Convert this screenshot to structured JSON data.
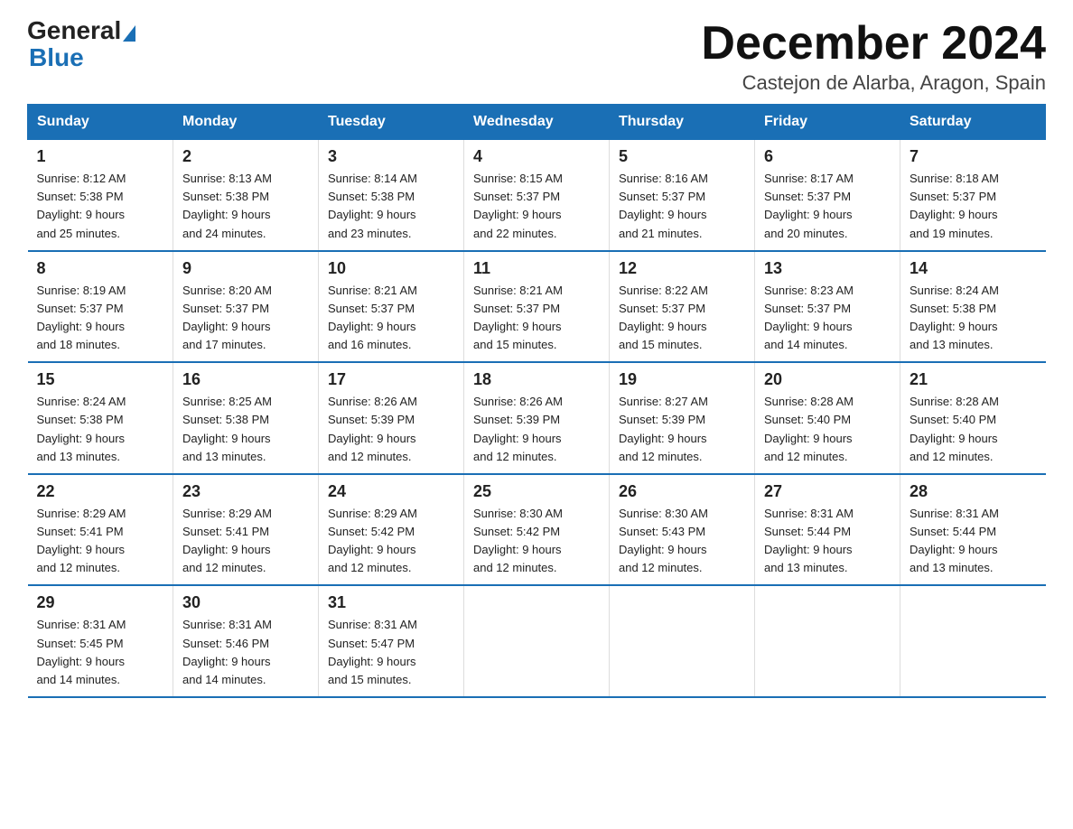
{
  "header": {
    "logo_general": "General",
    "logo_blue": "Blue",
    "month_title": "December 2024",
    "location": "Castejon de Alarba, Aragon, Spain"
  },
  "weekdays": [
    "Sunday",
    "Monday",
    "Tuesday",
    "Wednesday",
    "Thursday",
    "Friday",
    "Saturday"
  ],
  "weeks": [
    [
      {
        "day": "1",
        "sunrise": "8:12 AM",
        "sunset": "5:38 PM",
        "daylight": "9 hours and 25 minutes."
      },
      {
        "day": "2",
        "sunrise": "8:13 AM",
        "sunset": "5:38 PM",
        "daylight": "9 hours and 24 minutes."
      },
      {
        "day": "3",
        "sunrise": "8:14 AM",
        "sunset": "5:38 PM",
        "daylight": "9 hours and 23 minutes."
      },
      {
        "day": "4",
        "sunrise": "8:15 AM",
        "sunset": "5:37 PM",
        "daylight": "9 hours and 22 minutes."
      },
      {
        "day": "5",
        "sunrise": "8:16 AM",
        "sunset": "5:37 PM",
        "daylight": "9 hours and 21 minutes."
      },
      {
        "day": "6",
        "sunrise": "8:17 AM",
        "sunset": "5:37 PM",
        "daylight": "9 hours and 20 minutes."
      },
      {
        "day": "7",
        "sunrise": "8:18 AM",
        "sunset": "5:37 PM",
        "daylight": "9 hours and 19 minutes."
      }
    ],
    [
      {
        "day": "8",
        "sunrise": "8:19 AM",
        "sunset": "5:37 PM",
        "daylight": "9 hours and 18 minutes."
      },
      {
        "day": "9",
        "sunrise": "8:20 AM",
        "sunset": "5:37 PM",
        "daylight": "9 hours and 17 minutes."
      },
      {
        "day": "10",
        "sunrise": "8:21 AM",
        "sunset": "5:37 PM",
        "daylight": "9 hours and 16 minutes."
      },
      {
        "day": "11",
        "sunrise": "8:21 AM",
        "sunset": "5:37 PM",
        "daylight": "9 hours and 15 minutes."
      },
      {
        "day": "12",
        "sunrise": "8:22 AM",
        "sunset": "5:37 PM",
        "daylight": "9 hours and 15 minutes."
      },
      {
        "day": "13",
        "sunrise": "8:23 AM",
        "sunset": "5:37 PM",
        "daylight": "9 hours and 14 minutes."
      },
      {
        "day": "14",
        "sunrise": "8:24 AM",
        "sunset": "5:38 PM",
        "daylight": "9 hours and 13 minutes."
      }
    ],
    [
      {
        "day": "15",
        "sunrise": "8:24 AM",
        "sunset": "5:38 PM",
        "daylight": "9 hours and 13 minutes."
      },
      {
        "day": "16",
        "sunrise": "8:25 AM",
        "sunset": "5:38 PM",
        "daylight": "9 hours and 13 minutes."
      },
      {
        "day": "17",
        "sunrise": "8:26 AM",
        "sunset": "5:39 PM",
        "daylight": "9 hours and 12 minutes."
      },
      {
        "day": "18",
        "sunrise": "8:26 AM",
        "sunset": "5:39 PM",
        "daylight": "9 hours and 12 minutes."
      },
      {
        "day": "19",
        "sunrise": "8:27 AM",
        "sunset": "5:39 PM",
        "daylight": "9 hours and 12 minutes."
      },
      {
        "day": "20",
        "sunrise": "8:28 AM",
        "sunset": "5:40 PM",
        "daylight": "9 hours and 12 minutes."
      },
      {
        "day": "21",
        "sunrise": "8:28 AM",
        "sunset": "5:40 PM",
        "daylight": "9 hours and 12 minutes."
      }
    ],
    [
      {
        "day": "22",
        "sunrise": "8:29 AM",
        "sunset": "5:41 PM",
        "daylight": "9 hours and 12 minutes."
      },
      {
        "day": "23",
        "sunrise": "8:29 AM",
        "sunset": "5:41 PM",
        "daylight": "9 hours and 12 minutes."
      },
      {
        "day": "24",
        "sunrise": "8:29 AM",
        "sunset": "5:42 PM",
        "daylight": "9 hours and 12 minutes."
      },
      {
        "day": "25",
        "sunrise": "8:30 AM",
        "sunset": "5:42 PM",
        "daylight": "9 hours and 12 minutes."
      },
      {
        "day": "26",
        "sunrise": "8:30 AM",
        "sunset": "5:43 PM",
        "daylight": "9 hours and 12 minutes."
      },
      {
        "day": "27",
        "sunrise": "8:31 AM",
        "sunset": "5:44 PM",
        "daylight": "9 hours and 13 minutes."
      },
      {
        "day": "28",
        "sunrise": "8:31 AM",
        "sunset": "5:44 PM",
        "daylight": "9 hours and 13 minutes."
      }
    ],
    [
      {
        "day": "29",
        "sunrise": "8:31 AM",
        "sunset": "5:45 PM",
        "daylight": "9 hours and 14 minutes."
      },
      {
        "day": "30",
        "sunrise": "8:31 AM",
        "sunset": "5:46 PM",
        "daylight": "9 hours and 14 minutes."
      },
      {
        "day": "31",
        "sunrise": "8:31 AM",
        "sunset": "5:47 PM",
        "daylight": "9 hours and 15 minutes."
      },
      null,
      null,
      null,
      null
    ]
  ]
}
